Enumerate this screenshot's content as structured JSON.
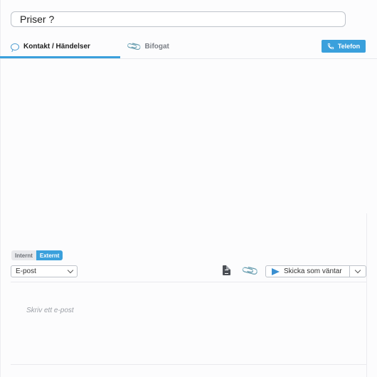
{
  "subject": {
    "value": "Priser ?"
  },
  "tabs": [
    {
      "label": "Kontakt / Händelser",
      "icon": "chat-bubble-icon",
      "active": true
    },
    {
      "label": "Bifogat",
      "icon": "paperclip-icon",
      "active": false
    }
  ],
  "header": {
    "phone_label": "Telefon"
  },
  "composer": {
    "internal_label": "Internt",
    "external_label": "Externt",
    "channel": "E-post",
    "send_label": "Skicka som väntar",
    "placeholder": "Skriv ett e-post"
  },
  "colors": {
    "accent": "#3aa0dc",
    "border": "#bfc4cb",
    "background": "#fcfcfd"
  }
}
